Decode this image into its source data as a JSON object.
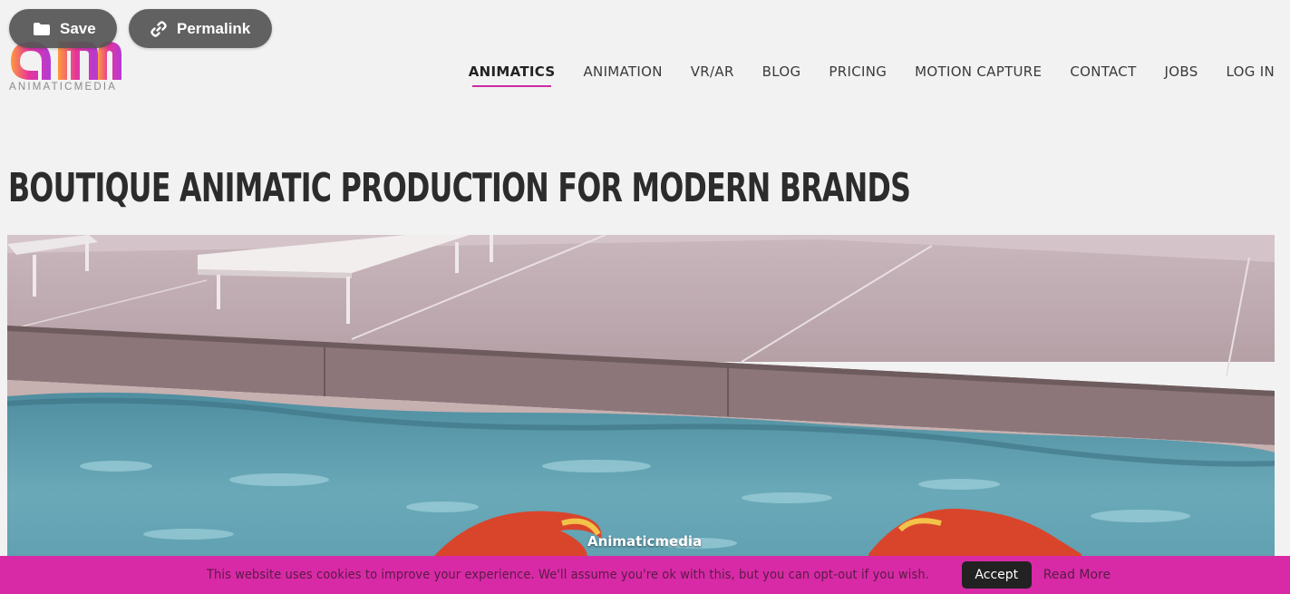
{
  "toolbar": {
    "save_label": "Save",
    "save_icon": "folder-icon",
    "permalink_label": "Permalink",
    "permalink_icon": "link-icon"
  },
  "logo": {
    "wordmark": "ANIMATICMEDIA",
    "monogram": "am",
    "colors": [
      "#ff9a3c",
      "#e6359a",
      "#b33ad6"
    ]
  },
  "nav": {
    "items": [
      {
        "label": "ANIMATICS",
        "active": true
      },
      {
        "label": "ANIMATION",
        "active": false
      },
      {
        "label": "VR/AR",
        "active": false
      },
      {
        "label": "BLOG",
        "active": false
      },
      {
        "label": "PRICING",
        "active": false
      },
      {
        "label": "MOTION CAPTURE",
        "active": false
      },
      {
        "label": "CONTACT",
        "active": false
      },
      {
        "label": "JOBS",
        "active": false
      },
      {
        "label": "LOG IN",
        "active": false
      }
    ],
    "accent_color": "#cc2aa3"
  },
  "main": {
    "headline": "BOUTIQUE ANIMATIC PRODUCTION FOR MODERN BRANDS",
    "video_watermark": "Animaticmedia"
  },
  "cookie_banner": {
    "message": "This website uses cookies to improve your experience. We'll assume you're ok with this, but you can opt-out if you wish.",
    "accept_label": "Accept",
    "read_more_label": "Read More",
    "background_color": "#d82aa6"
  }
}
